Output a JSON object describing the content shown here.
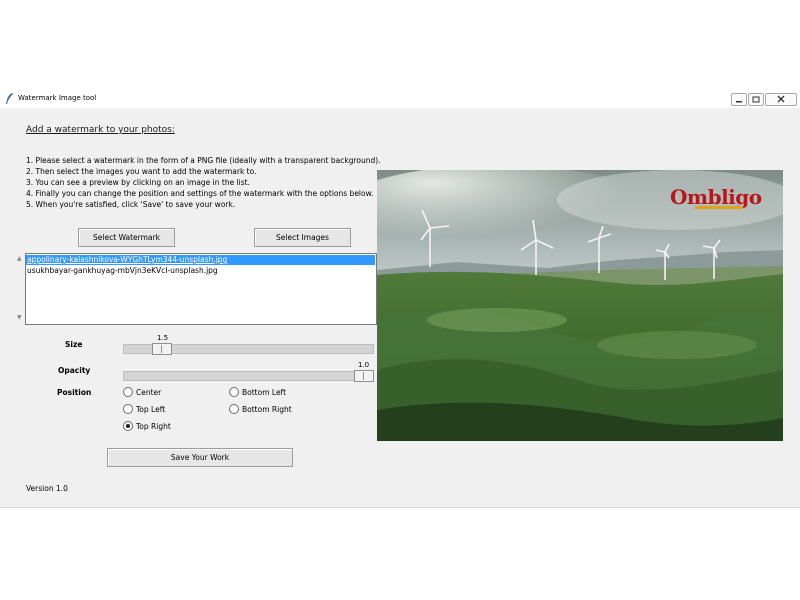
{
  "window": {
    "title": "Watermark Image tool",
    "controls": [
      "minimize-icon",
      "restore-icon",
      "close-icon"
    ]
  },
  "heading": "Add a watermark to your photos:",
  "instructions": [
    "1. Please select a watermark in the form of a PNG file (ideally with a transparent background).",
    "2. Then select the images you want to add the watermark to.",
    "3. You can see a preview by clicking on an image in the list.",
    "4. Finally you can change the position and settings of the watermark with the options below.",
    "5. When you're satisfied, click 'Save' to save your work."
  ],
  "buttons": {
    "select_watermark": "Select Watermark",
    "select_images": "Select Images",
    "save": "Save Your Work"
  },
  "image_list": {
    "items": [
      "appolinary-kalashnikova-WYGhTLym344-unsplash.jpg",
      "usukhbayar-gankhuyag-mbVjn3eKVcI-unsplash.jpg"
    ],
    "selected_index": 0
  },
  "size": {
    "label": "Size",
    "value": "1.5"
  },
  "opacity": {
    "label": "Opacity",
    "value": "1.0"
  },
  "position": {
    "label": "Position",
    "options": [
      "Center",
      "Top Left",
      "Top Right",
      "Bottom Left",
      "Bottom Right"
    ],
    "selected": "Top Right"
  },
  "preview": {
    "watermark_text": "Ombligo"
  },
  "version": "Version 1.0"
}
